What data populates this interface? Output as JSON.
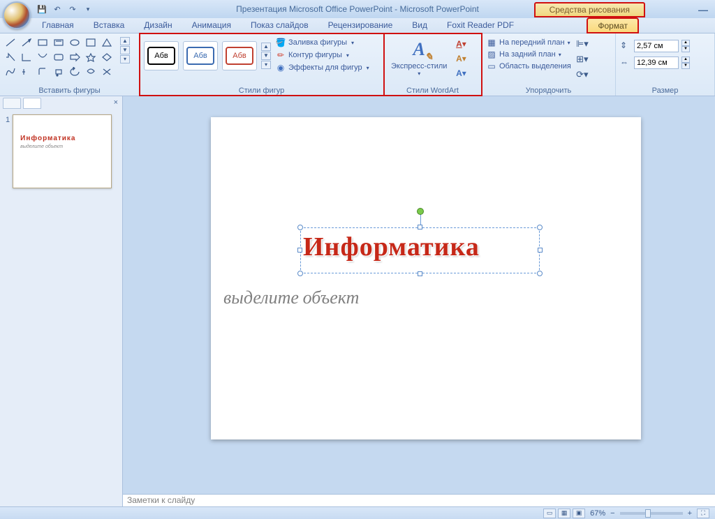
{
  "title": "Презентация Microsoft Office PowerPoint - Microsoft PowerPoint",
  "context_tab": "Средства рисования",
  "tabs": [
    "Главная",
    "Вставка",
    "Дизайн",
    "Анимация",
    "Показ слайдов",
    "Рецензирование",
    "Вид",
    "Foxit Reader PDF",
    "Формат"
  ],
  "groups": {
    "insert_shapes": "Вставить фигуры",
    "shape_styles": "Стили фигур",
    "wordart_styles": "Стили WordArt",
    "arrange": "Упорядочить",
    "size": "Размер"
  },
  "style_sample": "Абв",
  "shape_cmds": {
    "fill": "Заливка фигуры",
    "outline": "Контур фигуры",
    "effects": "Эффекты для фигур"
  },
  "wordart_label": "Экспресс-стили",
  "arrange_cmds": {
    "front": "На передний план",
    "back": "На задний план",
    "selection": "Область выделения"
  },
  "size_vals": {
    "height": "2,57 см",
    "width": "12,39 см"
  },
  "slide": {
    "num": "1",
    "title": "Информатика",
    "subtitle": "выделите объект"
  },
  "thumb": {
    "title": "Информатика",
    "subtitle": "выделите объект"
  },
  "notes_placeholder": "Заметки к слайду",
  "status": {
    "zoom": "67%"
  }
}
